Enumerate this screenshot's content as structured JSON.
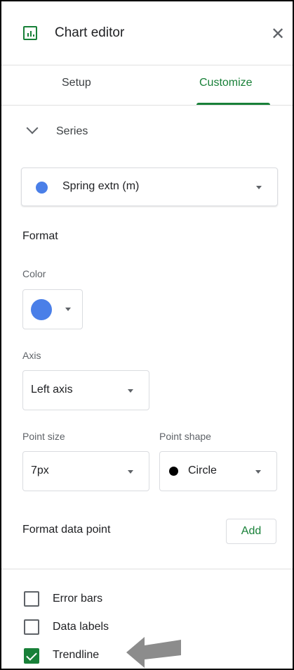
{
  "header": {
    "title": "Chart editor",
    "close_icon": "close-icon",
    "chart_icon": "bar-chart-icon"
  },
  "tabs": [
    {
      "label": "Setup",
      "active": false
    },
    {
      "label": "Customize",
      "active": true
    }
  ],
  "section": {
    "label": "Series",
    "icon": "chevron-down-icon"
  },
  "series_select": {
    "value": "Spring extn (m)",
    "dot_color": "#4a7fe8"
  },
  "format": {
    "heading": "Format",
    "color_label": "Color",
    "color_value": "#4a7fe8",
    "axis_label": "Axis",
    "axis_value": "Left axis",
    "point_size_label": "Point size",
    "point_size_value": "7px",
    "point_shape_label": "Point shape",
    "point_shape_value": "Circle"
  },
  "format_data_point": {
    "label": "Format data point",
    "button": "Add"
  },
  "options": [
    {
      "label": "Error bars",
      "checked": false
    },
    {
      "label": "Data labels",
      "checked": false
    },
    {
      "label": "Trendline",
      "checked": true
    }
  ],
  "annotation": {
    "icon": "arrow-left-icon",
    "color": "#8c8c8c"
  },
  "colors": {
    "accent": "#188038",
    "series": "#4a7fe8"
  }
}
